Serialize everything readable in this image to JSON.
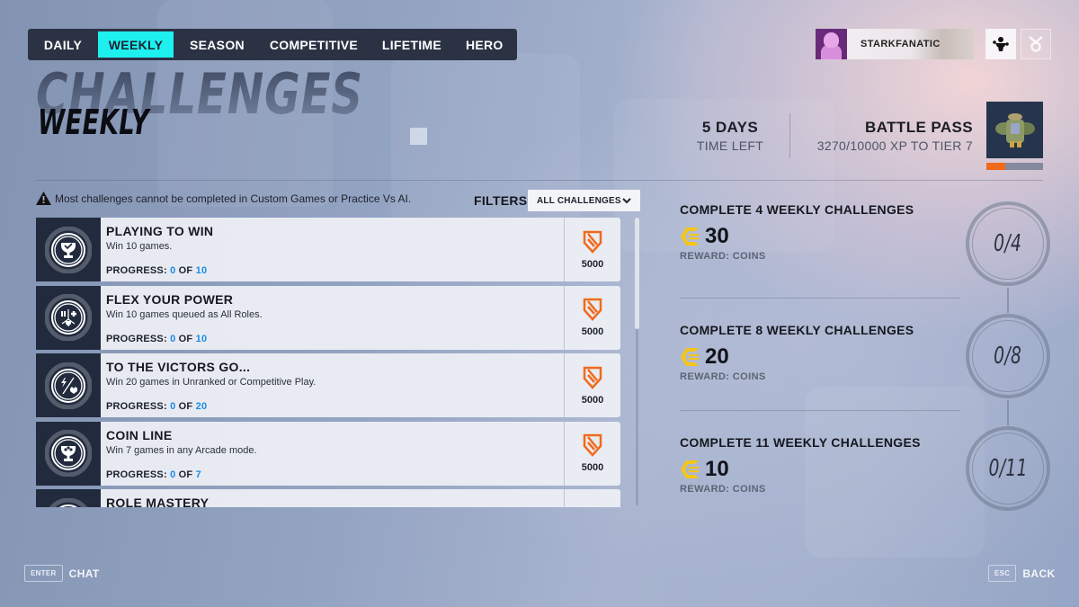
{
  "nav": {
    "tabs": [
      {
        "label": "DAILY",
        "active": false
      },
      {
        "label": "WEEKLY",
        "active": true
      },
      {
        "label": "SEASON",
        "active": false
      },
      {
        "label": "COMPETITIVE",
        "active": false
      },
      {
        "label": "LIFETIME",
        "active": false
      },
      {
        "label": "HERO",
        "active": false
      }
    ]
  },
  "player": {
    "name": "STARKFANATIC",
    "social_icon": "social-group-icon",
    "rewards_icon": "rewards-medal-icon"
  },
  "header": {
    "title": "CHALLENGES",
    "subtitle": "WEEKLY"
  },
  "timer": {
    "value": "5 DAYS",
    "label": "TIME LEFT"
  },
  "battle_pass": {
    "title": "BATTLE PASS",
    "progress_text": "3270/10000 XP TO TIER 7",
    "xp_current": 3270,
    "xp_total": 10000,
    "progress_fraction": 0.327,
    "accent_color": "#f06a1c"
  },
  "warning": {
    "icon": "warning-triangle-icon",
    "text": "Most challenges cannot be completed in Custom Games or Practice Vs AI."
  },
  "filters": {
    "label": "FILTERS",
    "selected": "ALL CHALLENGES"
  },
  "challenges": [
    {
      "title": "PLAYING TO WIN",
      "desc": "Win 10 games.",
      "progress_label": "PROGRESS:",
      "current": "0",
      "of": "OF",
      "target": "10",
      "reward": "5000",
      "icon": "trophy-check-icon"
    },
    {
      "title": "FLEX YOUR POWER",
      "desc": "Win 10 games queued as All Roles.",
      "progress_label": "PROGRESS:",
      "current": "0",
      "of": "OF",
      "target": "10",
      "reward": "5000",
      "icon": "all-roles-icon"
    },
    {
      "title": "TO THE VICTORS GO...",
      "desc": "Win 20 games in Unranked or Competitive Play.",
      "progress_label": "PROGRESS:",
      "current": "0",
      "of": "OF",
      "target": "20",
      "reward": "5000",
      "icon": "unranked-competitive-icon"
    },
    {
      "title": "COIN LINE",
      "desc": "Win 7 games in any Arcade mode.",
      "progress_label": "PROGRESS:",
      "current": "0",
      "of": "OF",
      "target": "7",
      "reward": "5000",
      "icon": "arcade-trophy-icon"
    },
    {
      "title": "ROLE MASTERY",
      "desc": "",
      "progress_label": "",
      "current": "",
      "of": "",
      "target": "",
      "reward": "",
      "icon": "role-mastery-icon"
    }
  ],
  "milestones": [
    {
      "title": "COMPLETE 4 WEEKLY CHALLENGES",
      "amount": "30",
      "reward_label": "REWARD:  COINS",
      "count": "0/4"
    },
    {
      "title": "COMPLETE 8 WEEKLY CHALLENGES",
      "amount": "20",
      "reward_label": "REWARD:  COINS",
      "count": "0/8"
    },
    {
      "title": "COMPLETE 11 WEEKLY CHALLENGES",
      "amount": "10",
      "reward_label": "REWARD:  COINS",
      "count": "0/11"
    }
  ],
  "footer": {
    "chat_key": "ENTER",
    "chat_label": "CHAT",
    "back_key": "ESC",
    "back_label": "BACK"
  },
  "colors": {
    "tab_active": "#1ef0f0",
    "progress_number": "#1a8de8",
    "coin": "#f5c518",
    "xp_icon": "#f06a1c"
  }
}
